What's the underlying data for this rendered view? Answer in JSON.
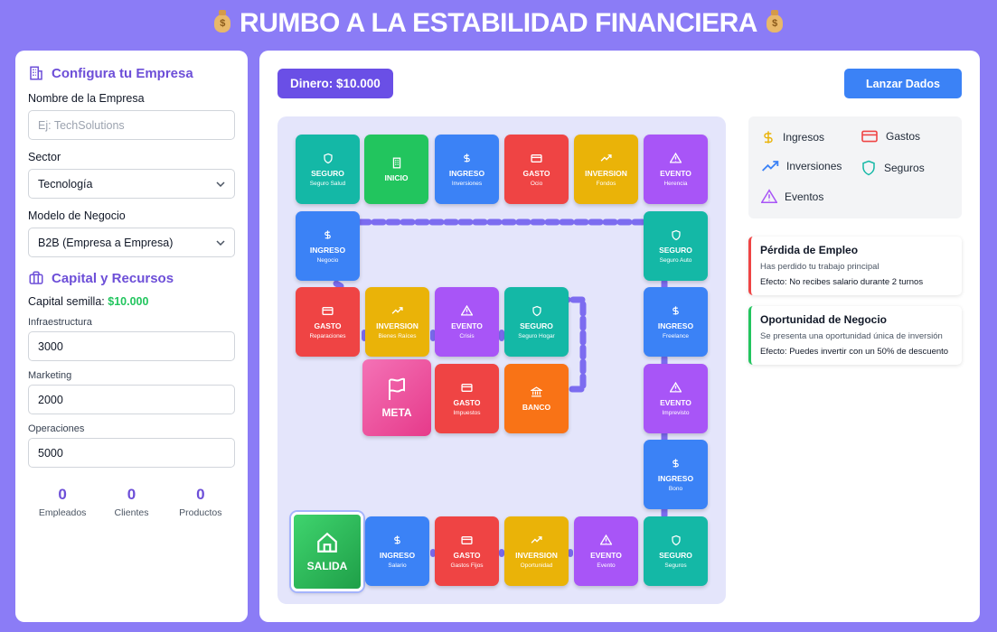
{
  "header": {
    "title": "RUMBO A LA ESTABILIDAD FINANCIERA",
    "icon": "money-bag-icon"
  },
  "config": {
    "title": "Configura tu Empresa",
    "company_label": "Nombre de la Empresa",
    "company_placeholder": "Ej: TechSolutions",
    "sector_label": "Sector",
    "sector_value": "Tecnología",
    "model_label": "Modelo de Negocio",
    "model_value": "B2B (Empresa a Empresa)"
  },
  "capital": {
    "title": "Capital y Recursos",
    "seed_label": "Capital semilla:",
    "seed_value": "$10.000",
    "infra_label": "Infraestructura",
    "infra_value": "3000",
    "marketing_label": "Marketing",
    "marketing_value": "2000",
    "ops_label": "Operaciones",
    "ops_value": "5000"
  },
  "stats": [
    {
      "value": "0",
      "label": "Empleados"
    },
    {
      "value": "0",
      "label": "Clientes"
    },
    {
      "value": "0",
      "label": "Productos"
    }
  ],
  "game": {
    "money": "Dinero: $10.000",
    "dice_button": "Lanzar Dados"
  },
  "tiles": [
    {
      "type": "SEGURO",
      "name": "Seguro Salud",
      "color": "#14b8a6",
      "icon": "shield-icon"
    },
    {
      "type": "INICIO",
      "name": "",
      "color": "#22c55e",
      "icon": "building-icon"
    },
    {
      "type": "INGRESO",
      "name": "Inversiones",
      "color": "#3b82f6",
      "icon": "dollar-icon"
    },
    {
      "type": "GASTO",
      "name": "Ocio",
      "color": "#ef4444",
      "icon": "card-icon"
    },
    {
      "type": "INVERSION",
      "name": "Fondos",
      "color": "#eab308",
      "icon": "trend-icon"
    },
    {
      "type": "EVENTO",
      "name": "Herencia",
      "color": "#a855f7",
      "icon": "alert-icon"
    },
    {
      "type": "INGRESO",
      "name": "Negocio",
      "color": "#3b82f6",
      "icon": "dollar-icon"
    },
    {
      "type": "SEGURO",
      "name": "Seguro Auto",
      "color": "#14b8a6",
      "icon": "shield-icon"
    },
    {
      "type": "GASTO",
      "name": "Reparaciones",
      "color": "#ef4444",
      "icon": "card-icon"
    },
    {
      "type": "INVERSION",
      "name": "Bienes Raíces",
      "color": "#eab308",
      "icon": "trend-icon"
    },
    {
      "type": "EVENTO",
      "name": "Crisis",
      "color": "#a855f7",
      "icon": "alert-icon"
    },
    {
      "type": "SEGURO",
      "name": "Seguro Hogar",
      "color": "#14b8a6",
      "icon": "shield-icon"
    },
    {
      "type": "INGRESO",
      "name": "Freelance",
      "color": "#3b82f6",
      "icon": "dollar-icon"
    },
    {
      "type": "META",
      "name": "",
      "color": "#ec4899",
      "icon": "flag-icon"
    },
    {
      "type": "GASTO",
      "name": "Impuestos",
      "color": "#ef4444",
      "icon": "card-icon"
    },
    {
      "type": "BANCO",
      "name": "",
      "color": "#f97316",
      "icon": "bank-icon"
    },
    {
      "type": "EVENTO",
      "name": "Imprevisto",
      "color": "#a855f7",
      "icon": "alert-icon"
    },
    {
      "type": "INGRESO",
      "name": "Bono",
      "color": "#3b82f6",
      "icon": "dollar-icon"
    },
    {
      "type": "SALIDA",
      "name": "",
      "color": "#22c55e",
      "icon": "home-icon"
    },
    {
      "type": "INGRESO",
      "name": "Salario",
      "color": "#3b82f6",
      "icon": "dollar-icon"
    },
    {
      "type": "GASTO",
      "name": "Gastos Fijos",
      "color": "#ef4444",
      "icon": "card-icon"
    },
    {
      "type": "INVERSION",
      "name": "Oportunidad",
      "color": "#eab308",
      "icon": "trend-icon"
    },
    {
      "type": "EVENTO",
      "name": "Evento",
      "color": "#a855f7",
      "icon": "alert-icon"
    },
    {
      "type": "SEGURO",
      "name": "Seguros",
      "color": "#14b8a6",
      "icon": "shield-icon"
    }
  ],
  "legend": [
    {
      "label": "Ingresos",
      "icon": "dollar-icon",
      "color": "#eab308"
    },
    {
      "label": "Gastos",
      "icon": "card-icon",
      "color": "#ef4444"
    },
    {
      "label": "Inversiones",
      "icon": "trend-icon",
      "color": "#3b82f6"
    },
    {
      "label": "Seguros",
      "icon": "shield-icon",
      "color": "#14b8a6"
    },
    {
      "label": "Eventos",
      "icon": "alert-icon",
      "color": "#a855f7"
    }
  ],
  "cards": [
    {
      "title": "Pérdida de Empleo",
      "desc": "Has perdido tu trabajo principal",
      "effect": "Efecto: No recibes salario durante 2 turnos"
    },
    {
      "title": "Oportunidad de Negocio",
      "desc": "Se presenta una oportunidad única de inversión",
      "effect": "Efecto: Puedes invertir con un 50% de descuento"
    }
  ]
}
